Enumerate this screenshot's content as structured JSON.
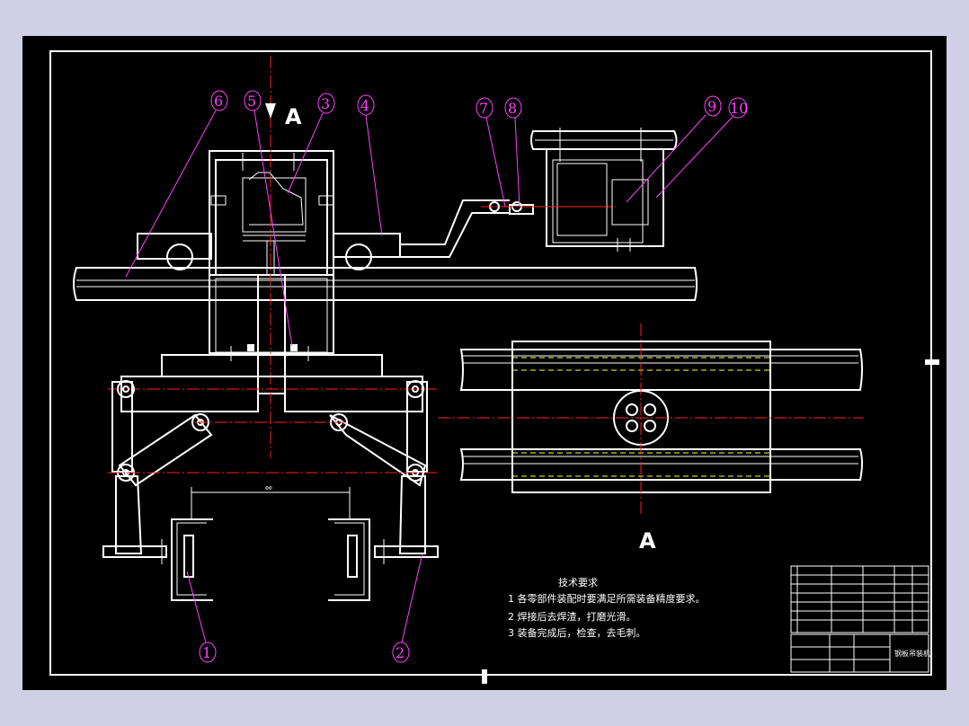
{
  "drawing": {
    "view_label_top": "A",
    "view_label_bottom": "A",
    "dimension_text": "ΦΦ",
    "balloons": [
      "1",
      "2",
      "3",
      "4",
      "5",
      "6",
      "7",
      "8",
      "9",
      "10"
    ],
    "tech_requirements": {
      "title": "技术要求",
      "items": [
        "1 各零部件装配时要满足所需装备精度要求。",
        "2 焊接后去焊渣，打磨光滑。",
        "3 装备完成后，检查，去毛刺。"
      ]
    },
    "title_block": {
      "main_name": "钢板吊装机"
    }
  },
  "colors": {
    "background": "#000000",
    "outline": "#ffffff",
    "centerline": "#ff2020",
    "hidden": "#ffff40",
    "leader": "#ff40ff",
    "frame": "#cfd0e6"
  }
}
